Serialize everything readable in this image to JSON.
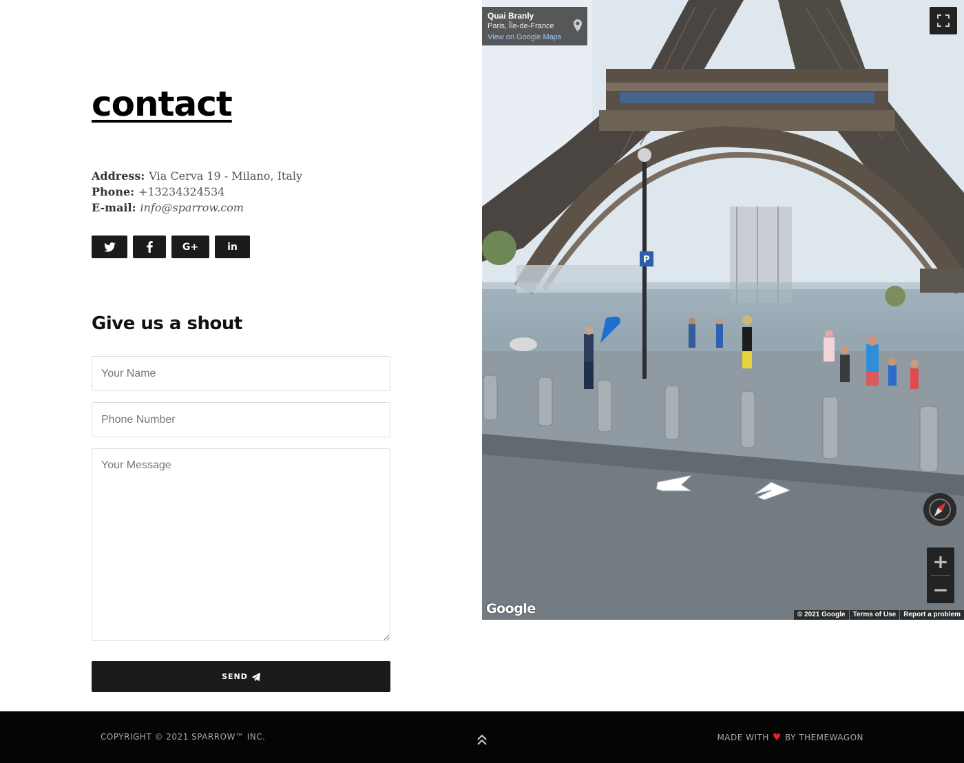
{
  "contact": {
    "title": "contact",
    "address_label": "Address:",
    "address_value": "Via Cerva 19 - Milano, Italy",
    "phone_label": "Phone:",
    "phone_value": "+13234324534",
    "email_label": "E-mail:",
    "email_value": "info@sparrow.com"
  },
  "socials": [
    {
      "name": "twitter-icon",
      "label": ""
    },
    {
      "name": "facebook-icon",
      "label": ""
    },
    {
      "name": "google-plus-icon",
      "label": "G+"
    },
    {
      "name": "linkedin-icon",
      "label": "in"
    }
  ],
  "form": {
    "heading": "Give us a shout",
    "name_placeholder": "Your Name",
    "phone_placeholder": "Phone Number",
    "message_placeholder": "Your Message",
    "send_label": "SEND"
  },
  "map": {
    "place_title": "Quai Branly",
    "place_subtitle": "Paris, Île-de-France",
    "place_link": "View on Google Maps",
    "logo": "Google",
    "attribution": [
      "© 2021 Google",
      "Terms of Use",
      "Report a problem"
    ],
    "zoom_in": "+",
    "zoom_out": "−"
  },
  "footer": {
    "copyright": "COPYRIGHT © 2021 SPARROW™ INC.",
    "made_prefix": "MADE WITH",
    "heart": "♥",
    "made_suffix": "BY THEMEWAGON"
  },
  "colors": {
    "dark": "#1b1b1b",
    "footer_bg": "#050505",
    "footer_text": "#a8a8a8",
    "heart": "#e8202b",
    "map_link": "#9cc6f5"
  }
}
